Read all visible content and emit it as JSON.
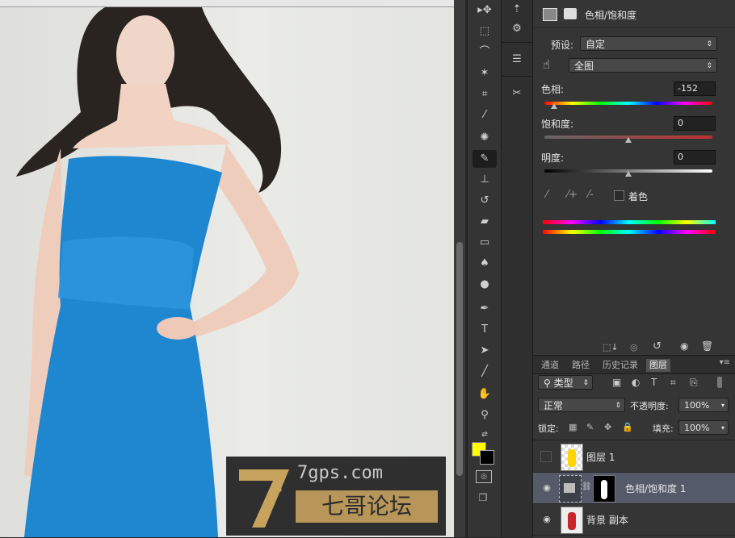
{
  "ruler": {
    "label": "ruler"
  },
  "tools": [
    {
      "name": "move-tool",
      "glyph": "▸✥"
    },
    {
      "name": "marquee-tool",
      "glyph": "⬚"
    },
    {
      "name": "lasso-tool",
      "glyph": "⌒"
    },
    {
      "name": "magic-wand-tool",
      "glyph": "✶"
    },
    {
      "name": "crop-tool",
      "glyph": "⌗"
    },
    {
      "name": "eyedropper-tool",
      "glyph": "⁄"
    },
    {
      "name": "spot-healing-tool",
      "glyph": "✺"
    },
    {
      "name": "brush-tool",
      "glyph": "✎"
    },
    {
      "name": "stamp-tool",
      "glyph": "⊥"
    },
    {
      "name": "history-brush-tool",
      "glyph": "↺"
    },
    {
      "name": "eraser-tool",
      "glyph": "▰"
    },
    {
      "name": "gradient-tool",
      "glyph": "▭"
    },
    {
      "name": "blur-tool",
      "glyph": "♠"
    },
    {
      "name": "dodge-tool",
      "glyph": "●"
    },
    {
      "name": "pen-tool",
      "glyph": "✒"
    },
    {
      "name": "type-tool",
      "glyph": "T"
    },
    {
      "name": "path-selection-tool",
      "glyph": "➤"
    },
    {
      "name": "line-tool",
      "glyph": "╱"
    },
    {
      "name": "hand-tool",
      "glyph": "✋"
    },
    {
      "name": "zoom-tool",
      "glyph": "⚲"
    }
  ],
  "colors": {
    "foreground": "#ffff00",
    "background": "#000000"
  },
  "properties": {
    "title": "色相/饱和度",
    "preset_label": "预设:",
    "preset_value": "自定",
    "channel_value": "全图",
    "hue_label": "色相:",
    "hue_value": "-152",
    "saturation_label": "饱和度:",
    "saturation_value": "0",
    "lightness_label": "明度:",
    "lightness_value": "0",
    "colorize_label": "着色"
  },
  "layers_panel": {
    "tabs": [
      "通道",
      "路径",
      "历史记录",
      "图层"
    ],
    "filter_type": "类型",
    "blend_mode": "正常",
    "opacity_label": "不透明度:",
    "opacity_value": "100%",
    "lock_label": "锁定:",
    "fill_label": "填充:",
    "fill_value": "100%",
    "layers": [
      {
        "name": "图层 1",
        "visible": false,
        "selected": false
      },
      {
        "name": "色相/饱和度 1",
        "visible": true,
        "selected": true
      },
      {
        "name": "背景 副本",
        "visible": true,
        "selected": false
      }
    ]
  },
  "watermark": {
    "url": "7gps.com",
    "text": "七哥论坛",
    "logo": "7G"
  }
}
